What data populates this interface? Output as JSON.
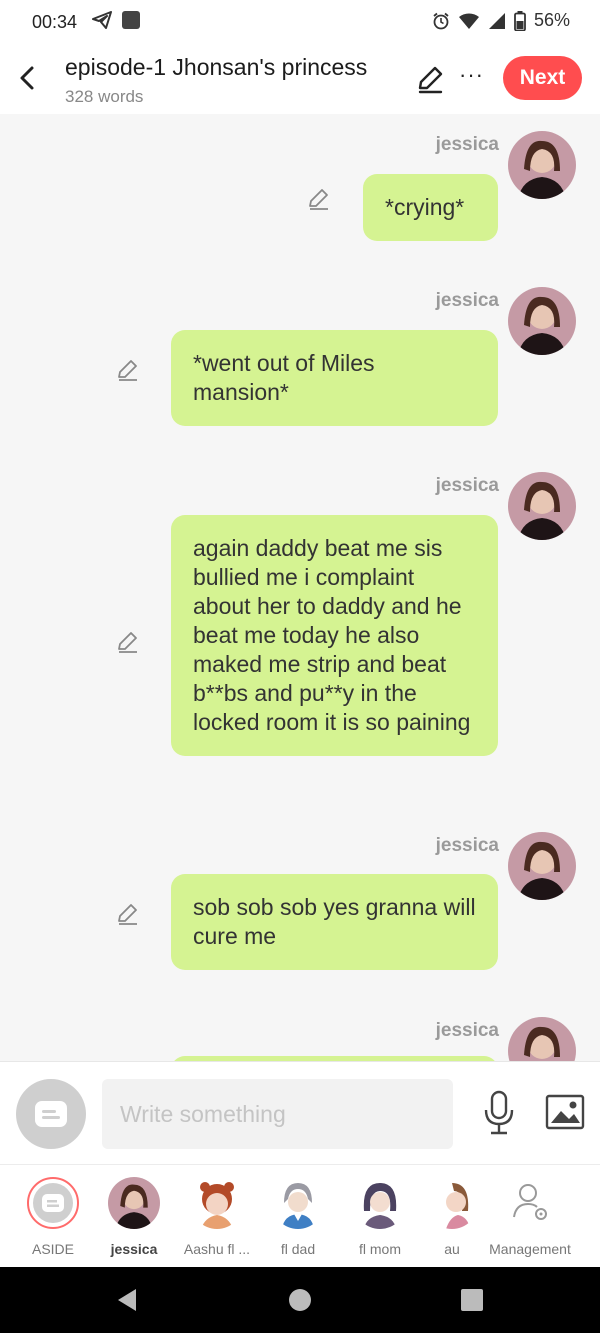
{
  "status": {
    "time": "00:34",
    "battery": "56%"
  },
  "header": {
    "title": "episode-1 Jhonsan's princess",
    "subtitle": "328 words",
    "next_label": "Next"
  },
  "messages": [
    {
      "name": "jessica",
      "text": "*crying*"
    },
    {
      "name": "jessica",
      "text": "*went out of Miles mansion*"
    },
    {
      "name": "jessica",
      "text": "again daddy beat me sis bullied me i complaint about her to daddy and he beat me today he also maked me strip and beat b**bs and pu**y in the locked room it is so paining"
    },
    {
      "name": "jessica",
      "text": "sob sob sob yes granna will cure me"
    },
    {
      "name": "jessica",
      "text": ""
    }
  ],
  "input": {
    "placeholder": "Write something"
  },
  "characters": [
    {
      "label": "ASIDE"
    },
    {
      "label": "jessica"
    },
    {
      "label": "Aashu fl ..."
    },
    {
      "label": "fl dad"
    },
    {
      "label": "fl mom"
    },
    {
      "label": "au"
    },
    {
      "label": "Management"
    }
  ],
  "colors": {
    "accent": "#ff4d4f",
    "bubble": "#d5f392"
  },
  "icons": [
    "telegram-icon",
    "notification-square-icon",
    "alarm-icon",
    "wifi-icon",
    "signal-icon",
    "battery-icon",
    "back-arrow-icon",
    "edit-pencil-icon",
    "more-icon",
    "mic-icon",
    "image-icon",
    "management-icon"
  ]
}
